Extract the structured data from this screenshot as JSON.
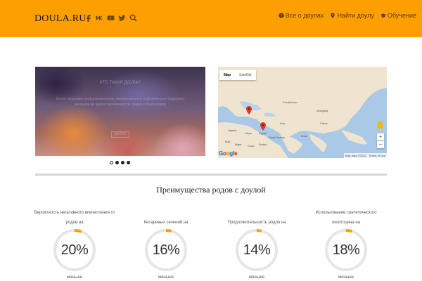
{
  "header": {
    "logo": "DOULA.RU",
    "social_icons": [
      "facebook-icon",
      "vk-icon",
      "youtube-icon",
      "twitter-icon",
      "search-icon"
    ],
    "nav": [
      {
        "label": "Все о доулах",
        "icon": "question-circle-icon"
      },
      {
        "label": "Найти доулу",
        "icon": "map-marker-icon"
      },
      {
        "label": "Обучение",
        "icon": "graduation-cap-icon"
      }
    ],
    "colors": {
      "accent": "#fe9f00"
    }
  },
  "slider": {
    "title": "КТО ТАКАЯ ДОУЛА?",
    "text": "Доула оказывает информационную, эмоциональную и физическую поддержку женщине во время беременности, родов и после родов",
    "button": "ДАЛЕЕ",
    "slides_count": 4,
    "active_slide": 1
  },
  "map": {
    "tabs": [
      "Map",
      "Satellite"
    ],
    "active_tab": "Map",
    "zoom_in": "+",
    "zoom_out": "−",
    "footer": [
      "Map data ©2016",
      "Terms of Use"
    ],
    "logo": "Google",
    "labels": [
      "Kazakhstan",
      "Mongolia",
      "China",
      "Iran",
      "Saudi Arabia",
      "Egypt",
      "Libya",
      "Mali",
      "Niger",
      "Chad",
      "Sudan",
      "India",
      "Algeria"
    ]
  },
  "section": {
    "title": "Преимущества родов с доулой"
  },
  "stats": [
    {
      "label": "Вероятность негативного впечатления от родов на",
      "value": "20%",
      "fraction": 0.2,
      "sub": "меньше"
    },
    {
      "label": "Кесаревых сечений на",
      "value": "16%",
      "fraction": 0.16,
      "sub": "меньше"
    },
    {
      "label": "Продолжительность родов на",
      "value": "14%",
      "fraction": 0.14,
      "sub": "меньше"
    },
    {
      "label": "Использование синтетического окситоцина на",
      "value": "18%",
      "fraction": 0.18,
      "sub": "меньше"
    }
  ]
}
